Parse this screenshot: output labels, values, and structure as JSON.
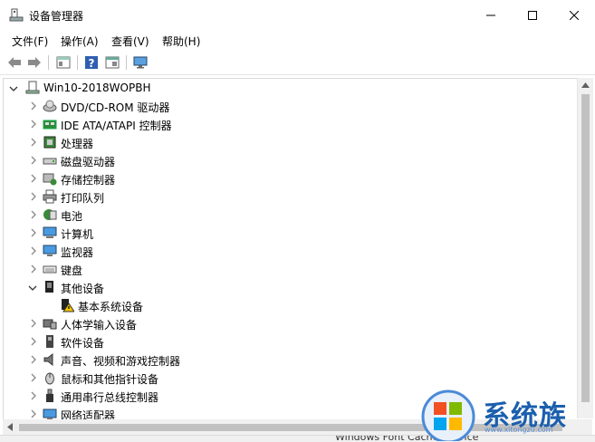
{
  "window": {
    "title": "设备管理器",
    "controls": {
      "minimize": "─",
      "maximize": "☐",
      "close": "✕"
    }
  },
  "menu": [
    {
      "label": "文件(F)"
    },
    {
      "label": "操作(A)"
    },
    {
      "label": "查看(V)"
    },
    {
      "label": "帮助(H)"
    }
  ],
  "toolbar": {
    "icons": [
      "back-arrow-icon",
      "forward-arrow-icon",
      "properties-icon",
      "help-icon",
      "view-icon",
      "monitor-icon"
    ]
  },
  "tree": {
    "root": "Win10-2018WOPBH",
    "items": [
      {
        "label": "DVD/CD-ROM 驱动器",
        "icon": "dvd-drive-icon",
        "expanded": false
      },
      {
        "label": "IDE ATA/ATAPI 控制器",
        "icon": "ide-controller-icon",
        "expanded": false
      },
      {
        "label": "处理器",
        "icon": "processor-icon",
        "expanded": false
      },
      {
        "label": "磁盘驱动器",
        "icon": "disk-drive-icon",
        "expanded": false
      },
      {
        "label": "存储控制器",
        "icon": "storage-controller-icon",
        "expanded": false
      },
      {
        "label": "打印队列",
        "icon": "printer-icon",
        "expanded": false
      },
      {
        "label": "电池",
        "icon": "battery-icon",
        "expanded": false
      },
      {
        "label": "计算机",
        "icon": "computer-icon",
        "expanded": false
      },
      {
        "label": "监视器",
        "icon": "monitor-icon",
        "expanded": false
      },
      {
        "label": "键盘",
        "icon": "keyboard-icon",
        "expanded": false
      },
      {
        "label": "其他设备",
        "icon": "other-devices-icon",
        "expanded": true,
        "children": [
          {
            "label": "基本系统设备",
            "icon": "warning-device-icon"
          }
        ]
      },
      {
        "label": "人体学输入设备",
        "icon": "hid-icon",
        "expanded": false
      },
      {
        "label": "软件设备",
        "icon": "software-device-icon",
        "expanded": false
      },
      {
        "label": "声音、视频和游戏控制器",
        "icon": "sound-icon",
        "expanded": false
      },
      {
        "label": "鼠标和其他指针设备",
        "icon": "mouse-icon",
        "expanded": false
      },
      {
        "label": "通用串行总线控制器",
        "icon": "usb-icon",
        "expanded": false
      },
      {
        "label": "网络适配器",
        "icon": "network-adapter-icon",
        "expanded": false
      }
    ]
  },
  "statusbar": {
    "text": "Windows Font Cache Service"
  },
  "watermark": {
    "text": "系统族",
    "url": "www.xitongzu.com"
  },
  "colors": {
    "accent": "#0078d7",
    "watermark": "#1b5fae"
  }
}
